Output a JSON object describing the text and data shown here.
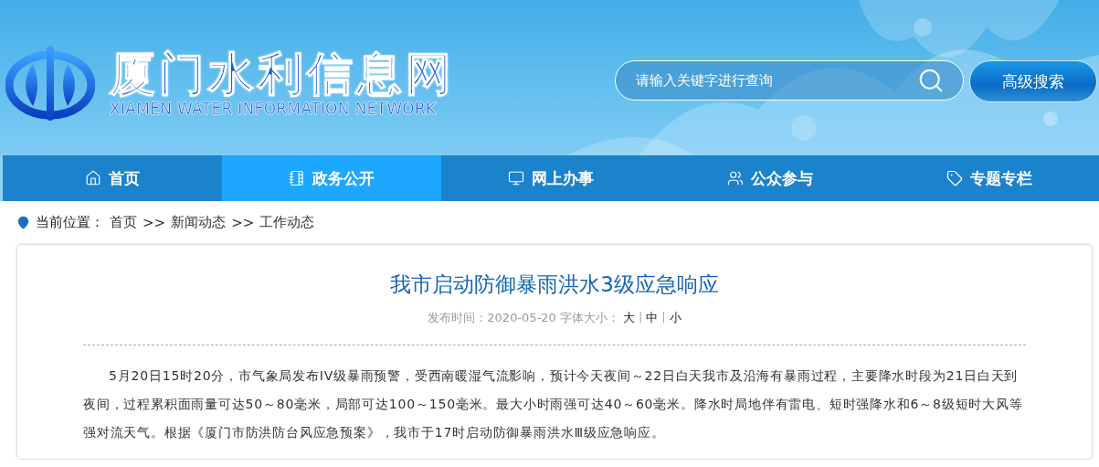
{
  "site": {
    "title": "厦门水利信息网",
    "subtitle": "XIAMEN WATER INFORMATION NETWORK"
  },
  "search": {
    "placeholder": "请输入关键字进行查询",
    "advanced_button": "高级搜索"
  },
  "nav": [
    {
      "kind": "home",
      "label": "首页",
      "selected": false
    },
    {
      "kind": "doc",
      "label": "政务公开",
      "selected": true
    },
    {
      "kind": "monitor",
      "label": "网上办事",
      "selected": false
    },
    {
      "kind": "users",
      "label": "公众参与",
      "selected": false
    },
    {
      "kind": "tag",
      "label": "专题专栏",
      "selected": false
    }
  ],
  "breadcrumb": {
    "label": "当前位置：",
    "items": [
      "首页",
      "新闻动态",
      "工作动态"
    ],
    "separator": ">>"
  },
  "article": {
    "title": "我市启动防御暴雨洪水3级应急响应",
    "publish_label": "发布时间：2020-05-20",
    "font_size_label": "字体大小：",
    "font_sizes": [
      "大",
      "中",
      "小"
    ],
    "font_size_separator": "|",
    "body": "5月20日15时20分，市气象局发布IV级暴雨预警，受西南暖湿气流影响，预计今天夜间～22日白天我市及沿海有暴雨过程，主要降水时段为21日白天到夜间，过程累积面雨量可达50～80毫米，局部可达100～150毫米。最大小时雨强可达40～60毫米。降水时局地伴有雷电、短时强降水和6～8级短时大风等强对流天气。根据《厦门市防洪防台风应急预案》，我市于17时启动防御暴雨洪水Ⅲ级应急响应。"
  }
}
